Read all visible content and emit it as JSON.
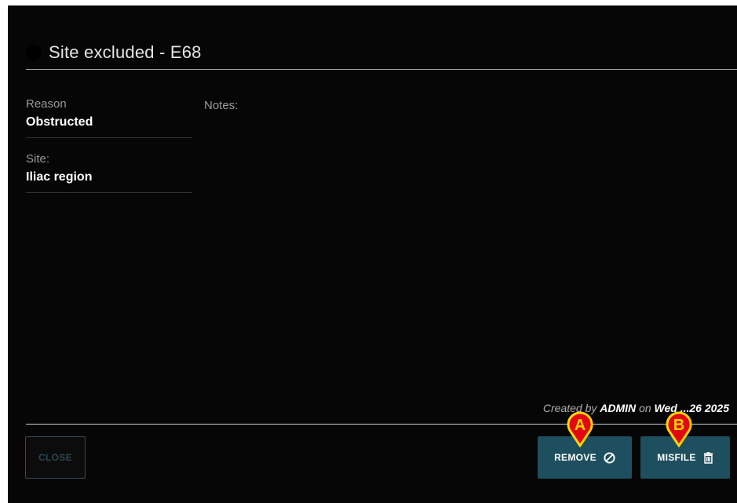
{
  "dialog": {
    "title": "Site excluded - E68",
    "fields": [
      {
        "label": "Reason",
        "value": "Obstructed"
      },
      {
        "label": "Site:",
        "value": "Iliac region"
      }
    ],
    "notes_label": "Notes:",
    "created": {
      "prefix": "Created by",
      "user": "ADMIN",
      "on": "on",
      "date": "Wed ...26 2025"
    }
  },
  "buttons": {
    "close": "CLOSE",
    "remove": "REMOVE",
    "misfile": "MISFILE"
  },
  "markers": {
    "a": "A",
    "b": "B"
  },
  "icons": {
    "remove": "prohibit-icon",
    "misfile": "trash-icon",
    "marker": "map-pin-icon"
  },
  "colors": {
    "background": "#060606",
    "button_fill": "#1d4f5e",
    "marker_fill": "#e30613",
    "marker_ring": "#ffd400"
  }
}
